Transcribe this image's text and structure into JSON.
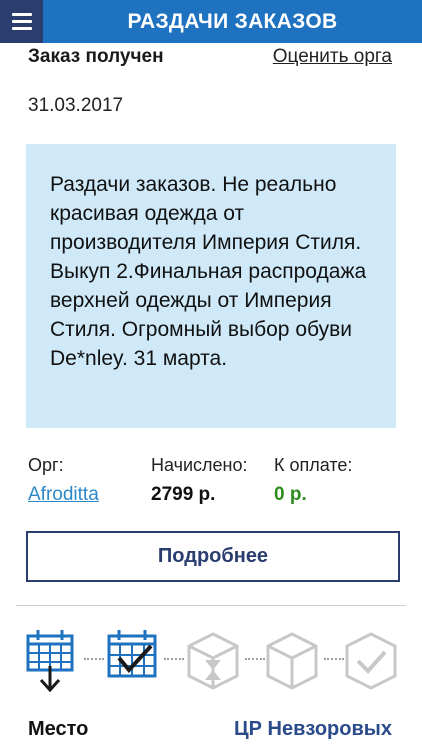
{
  "header": {
    "title": "РАЗДАЧИ ЗАКАЗОВ"
  },
  "order": {
    "status": "Заказ получен",
    "rate_link": "Оценить орга",
    "date": "31.03.2017",
    "description": "Раздачи заказов. Не реально красивая одежда от производителя Империя Стиля. Выкуп 2.Финальная распродажа верхней одежды от Империя Стиля. Огромный выбор обуви De*nley. 31 марта."
  },
  "summary": {
    "org_label": "Орг:",
    "org_value": "Afroditta",
    "charged_label": "Начислено:",
    "charged_value": "2799 р.",
    "to_pay_label": "К оплате:",
    "to_pay_value": "0 р."
  },
  "more_button": "Подробнее",
  "steps": [
    {
      "icon": "calendar-download-icon",
      "state": "done"
    },
    {
      "icon": "calendar-check-icon",
      "state": "done"
    },
    {
      "icon": "box-hourglass-icon",
      "state": "pending"
    },
    {
      "icon": "box-icon",
      "state": "pending"
    },
    {
      "icon": "check-circle-icon",
      "state": "pending"
    }
  ],
  "place": {
    "label": "Место",
    "value": "ЦР Невзоровых"
  },
  "colors": {
    "header": "#1e72c0",
    "menu": "#2a3d6e",
    "info_box": "#cfe9f9",
    "link": "#2d88c6",
    "to_pay": "#2e8b1e",
    "step_active": "#1e72c0",
    "step_inactive": "#c8c8c8"
  }
}
